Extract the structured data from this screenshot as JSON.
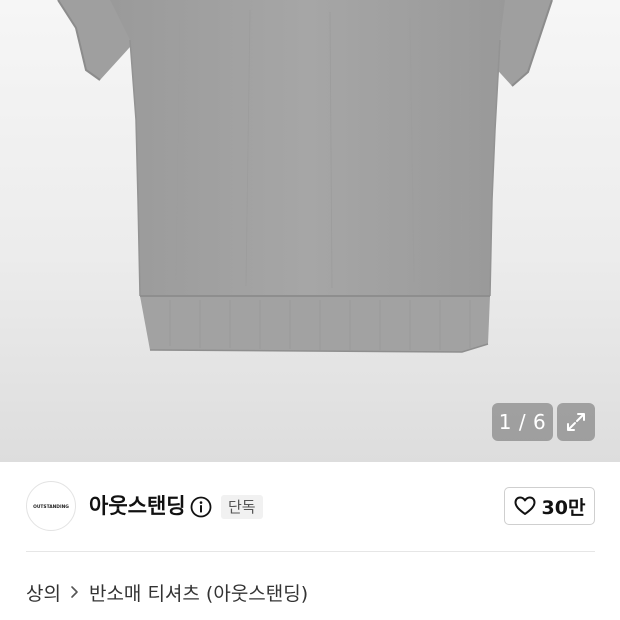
{
  "gallery": {
    "current": 1,
    "total": 6,
    "counter_text": "1 / 6",
    "expand_icon": "expand-arrows-icon",
    "image_subject": "gray-short-sleeve-sweatshirt"
  },
  "brand": {
    "logo_text": "OUTSTANDING",
    "name": "아웃스탠딩",
    "info_icon": "info-icon",
    "badge": "단독",
    "like_icon": "heart-outline-icon",
    "like_count": "30만"
  },
  "breadcrumb": {
    "items": [
      "상의",
      "반소매 티셔츠 (아웃스탠딩)"
    ],
    "separator_icon": "chevron-right-icon"
  },
  "colors": {
    "shirt": "#a3a3a3",
    "overlay": "#787878",
    "badge_bg": "#f1f1f1",
    "border": "#cfcfcf"
  }
}
